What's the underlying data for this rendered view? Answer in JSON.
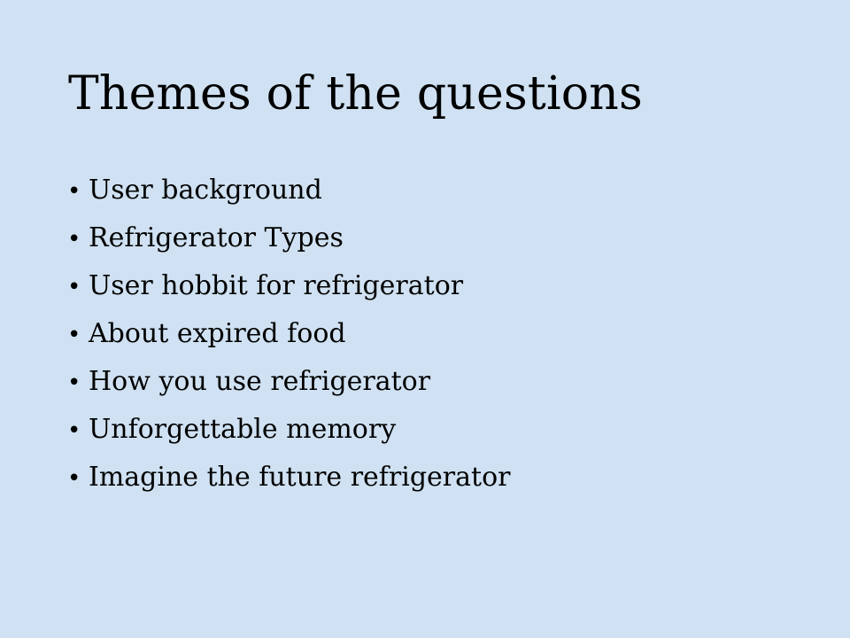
{
  "slide": {
    "title": "Themes of the questions",
    "bullet_mark": "•",
    "items": [
      {
        "label": "User background"
      },
      {
        "label": "Refrigerator Types"
      },
      {
        "label": "User hobbit for refrigerator"
      },
      {
        "label": "About expired food"
      },
      {
        "label": "How you use refrigerator"
      },
      {
        "label": "Unforgettable memory"
      },
      {
        "label": "Imagine the future refrigerator"
      }
    ]
  },
  "colors": {
    "background": "#cfe1f2",
    "text": "#000000"
  }
}
